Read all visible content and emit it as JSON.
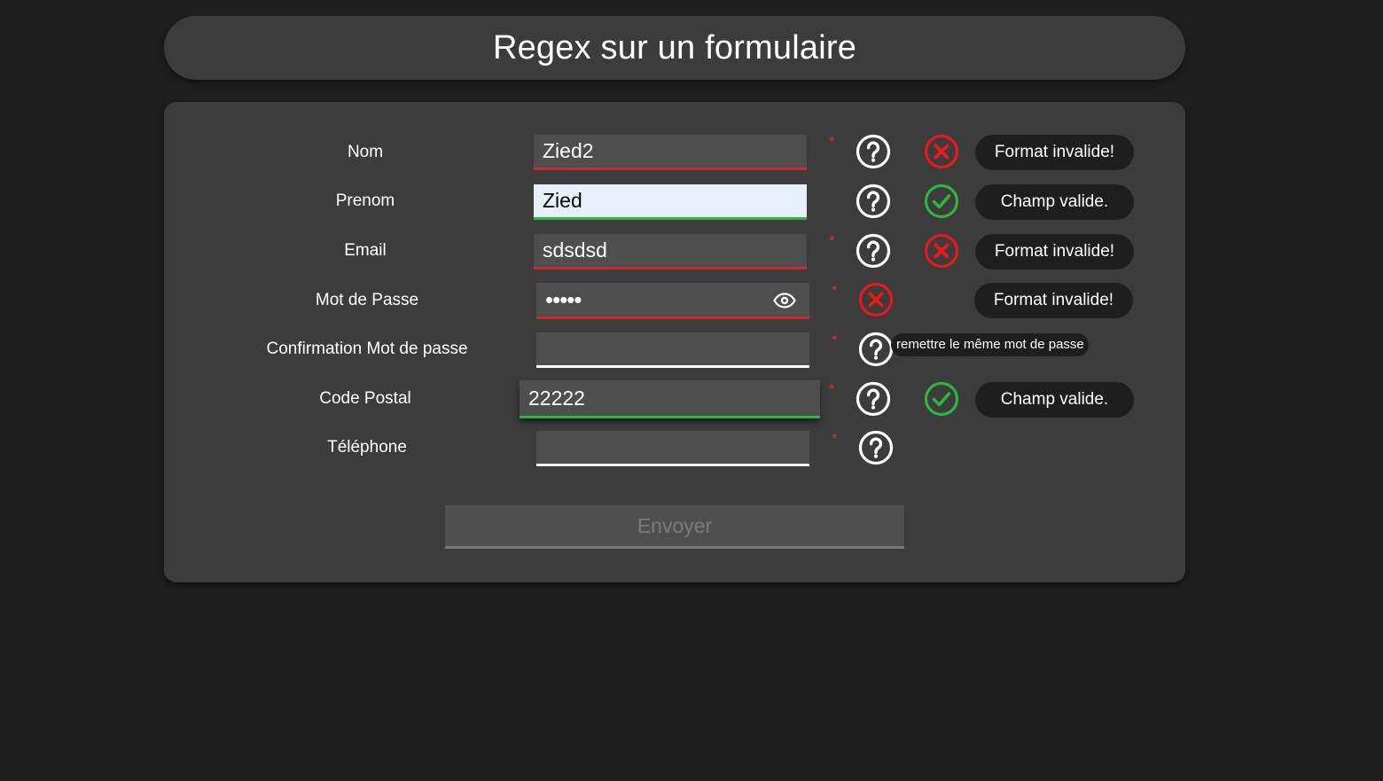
{
  "page": {
    "title": "Regex sur un formulaire"
  },
  "form": {
    "nom": {
      "label": "Nom",
      "value": "Zied2",
      "required": "*",
      "status_message": "Format invalide!",
      "status_icon": "error-icon"
    },
    "prenom": {
      "label": "Prenom",
      "value": "Zied",
      "status_message": "Champ valide.",
      "status_icon": "check-icon"
    },
    "email": {
      "label": "Email",
      "value": "sdsdsd",
      "required": "*",
      "status_message": "Format invalide!",
      "status_icon": "error-icon"
    },
    "password": {
      "label": "Mot de Passe",
      "value": "12345",
      "required": "*",
      "status_message": "Format invalide!",
      "status_icon": "error-icon",
      "toggle_icon": "eye-icon"
    },
    "confirm_password": {
      "label": "Confirmation Mot de passe",
      "value": "",
      "required": "*",
      "help_tooltip": "remettre le même mot de passe"
    },
    "code_postal": {
      "label": "Code Postal",
      "value": "22222",
      "required": "*",
      "status_message": "Champ valide.",
      "status_icon": "check-icon"
    },
    "telephone": {
      "label": "Téléphone",
      "value": "",
      "required": "*"
    },
    "submit_label": "Envoyer"
  },
  "colors": {
    "background": "#1e1e1e",
    "panel": "#3c3c3c",
    "input": "#4e4e4e",
    "autofill_input": "#e8f0fe",
    "invalid": "#cc2b2b",
    "valid": "#2fb53a",
    "error_icon": "#e8191b",
    "check_icon": "#2fb53a",
    "required_star": "#e03030"
  }
}
